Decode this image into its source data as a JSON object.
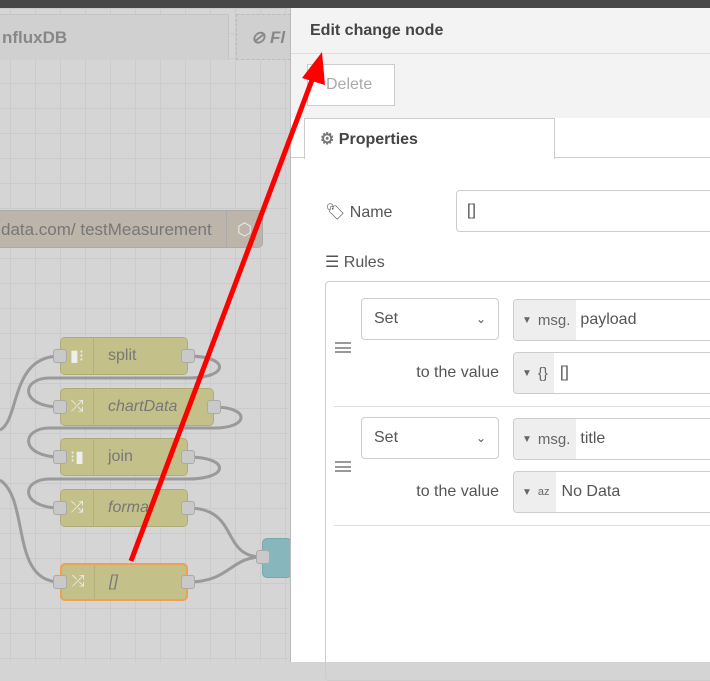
{
  "canvas": {
    "tabs": [
      {
        "label": "nfluxDB"
      },
      {
        "label": "Fl"
      }
    ],
    "influx_node": {
      "label": "data.com/ testMeasurement"
    },
    "nodes": [
      {
        "label": "split",
        "type": "split"
      },
      {
        "label": "chartData",
        "type": "change"
      },
      {
        "label": "join",
        "type": "join"
      },
      {
        "label": "format",
        "type": "change"
      },
      {
        "label": "[]",
        "type": "change",
        "selected": true
      }
    ]
  },
  "editor": {
    "title": "Edit change node",
    "delete_label": "Delete",
    "tab_label": "Properties",
    "name_label": "Name",
    "name_value": "[]",
    "rules_label": "Rules",
    "rules": [
      {
        "action": "Set",
        "target_type": "msg.",
        "target": "payload",
        "to_label": "to the value",
        "value_type": "{}",
        "value": "[]"
      },
      {
        "action": "Set",
        "target_type": "msg.",
        "target": "title",
        "to_label": "to the value",
        "value_type": "az",
        "value": "No Data"
      }
    ]
  },
  "colors": {
    "annotation_arrow": "#ff0000",
    "selected_node_border": "#f0a050",
    "node_fill": "#c4c08a"
  }
}
